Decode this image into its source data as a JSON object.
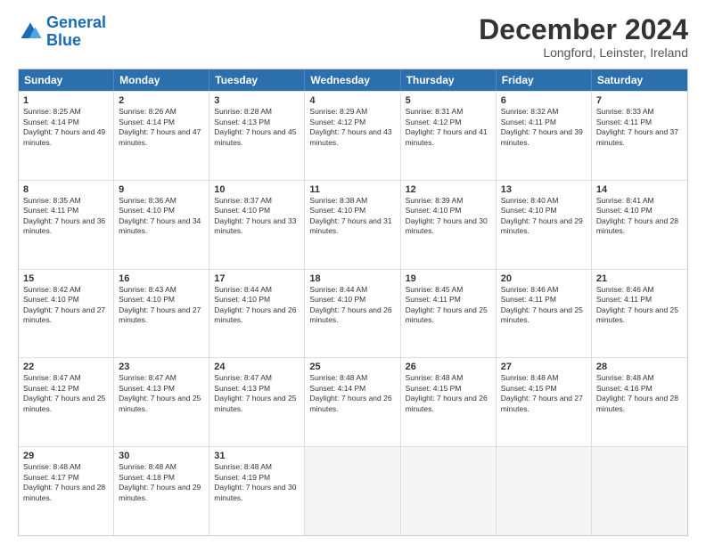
{
  "header": {
    "logo_line1": "General",
    "logo_line2": "Blue",
    "month": "December 2024",
    "location": "Longford, Leinster, Ireland"
  },
  "weekdays": [
    "Sunday",
    "Monday",
    "Tuesday",
    "Wednesday",
    "Thursday",
    "Friday",
    "Saturday"
  ],
  "weeks": [
    [
      {
        "day": "1",
        "rise": "Sunrise: 8:25 AM",
        "set": "Sunset: 4:14 PM",
        "daylight": "Daylight: 7 hours and 49 minutes."
      },
      {
        "day": "2",
        "rise": "Sunrise: 8:26 AM",
        "set": "Sunset: 4:14 PM",
        "daylight": "Daylight: 7 hours and 47 minutes."
      },
      {
        "day": "3",
        "rise": "Sunrise: 8:28 AM",
        "set": "Sunset: 4:13 PM",
        "daylight": "Daylight: 7 hours and 45 minutes."
      },
      {
        "day": "4",
        "rise": "Sunrise: 8:29 AM",
        "set": "Sunset: 4:12 PM",
        "daylight": "Daylight: 7 hours and 43 minutes."
      },
      {
        "day": "5",
        "rise": "Sunrise: 8:31 AM",
        "set": "Sunset: 4:12 PM",
        "daylight": "Daylight: 7 hours and 41 minutes."
      },
      {
        "day": "6",
        "rise": "Sunrise: 8:32 AM",
        "set": "Sunset: 4:11 PM",
        "daylight": "Daylight: 7 hours and 39 minutes."
      },
      {
        "day": "7",
        "rise": "Sunrise: 8:33 AM",
        "set": "Sunset: 4:11 PM",
        "daylight": "Daylight: 7 hours and 37 minutes."
      }
    ],
    [
      {
        "day": "8",
        "rise": "Sunrise: 8:35 AM",
        "set": "Sunset: 4:11 PM",
        "daylight": "Daylight: 7 hours and 36 minutes."
      },
      {
        "day": "9",
        "rise": "Sunrise: 8:36 AM",
        "set": "Sunset: 4:10 PM",
        "daylight": "Daylight: 7 hours and 34 minutes."
      },
      {
        "day": "10",
        "rise": "Sunrise: 8:37 AM",
        "set": "Sunset: 4:10 PM",
        "daylight": "Daylight: 7 hours and 33 minutes."
      },
      {
        "day": "11",
        "rise": "Sunrise: 8:38 AM",
        "set": "Sunset: 4:10 PM",
        "daylight": "Daylight: 7 hours and 31 minutes."
      },
      {
        "day": "12",
        "rise": "Sunrise: 8:39 AM",
        "set": "Sunset: 4:10 PM",
        "daylight": "Daylight: 7 hours and 30 minutes."
      },
      {
        "day": "13",
        "rise": "Sunrise: 8:40 AM",
        "set": "Sunset: 4:10 PM",
        "daylight": "Daylight: 7 hours and 29 minutes."
      },
      {
        "day": "14",
        "rise": "Sunrise: 8:41 AM",
        "set": "Sunset: 4:10 PM",
        "daylight": "Daylight: 7 hours and 28 minutes."
      }
    ],
    [
      {
        "day": "15",
        "rise": "Sunrise: 8:42 AM",
        "set": "Sunset: 4:10 PM",
        "daylight": "Daylight: 7 hours and 27 minutes."
      },
      {
        "day": "16",
        "rise": "Sunrise: 8:43 AM",
        "set": "Sunset: 4:10 PM",
        "daylight": "Daylight: 7 hours and 27 minutes."
      },
      {
        "day": "17",
        "rise": "Sunrise: 8:44 AM",
        "set": "Sunset: 4:10 PM",
        "daylight": "Daylight: 7 hours and 26 minutes."
      },
      {
        "day": "18",
        "rise": "Sunrise: 8:44 AM",
        "set": "Sunset: 4:10 PM",
        "daylight": "Daylight: 7 hours and 26 minutes."
      },
      {
        "day": "19",
        "rise": "Sunrise: 8:45 AM",
        "set": "Sunset: 4:11 PM",
        "daylight": "Daylight: 7 hours and 25 minutes."
      },
      {
        "day": "20",
        "rise": "Sunrise: 8:46 AM",
        "set": "Sunset: 4:11 PM",
        "daylight": "Daylight: 7 hours and 25 minutes."
      },
      {
        "day": "21",
        "rise": "Sunrise: 8:46 AM",
        "set": "Sunset: 4:11 PM",
        "daylight": "Daylight: 7 hours and 25 minutes."
      }
    ],
    [
      {
        "day": "22",
        "rise": "Sunrise: 8:47 AM",
        "set": "Sunset: 4:12 PM",
        "daylight": "Daylight: 7 hours and 25 minutes."
      },
      {
        "day": "23",
        "rise": "Sunrise: 8:47 AM",
        "set": "Sunset: 4:13 PM",
        "daylight": "Daylight: 7 hours and 25 minutes."
      },
      {
        "day": "24",
        "rise": "Sunrise: 8:47 AM",
        "set": "Sunset: 4:13 PM",
        "daylight": "Daylight: 7 hours and 25 minutes."
      },
      {
        "day": "25",
        "rise": "Sunrise: 8:48 AM",
        "set": "Sunset: 4:14 PM",
        "daylight": "Daylight: 7 hours and 26 minutes."
      },
      {
        "day": "26",
        "rise": "Sunrise: 8:48 AM",
        "set": "Sunset: 4:15 PM",
        "daylight": "Daylight: 7 hours and 26 minutes."
      },
      {
        "day": "27",
        "rise": "Sunrise: 8:48 AM",
        "set": "Sunset: 4:15 PM",
        "daylight": "Daylight: 7 hours and 27 minutes."
      },
      {
        "day": "28",
        "rise": "Sunrise: 8:48 AM",
        "set": "Sunset: 4:16 PM",
        "daylight": "Daylight: 7 hours and 28 minutes."
      }
    ],
    [
      {
        "day": "29",
        "rise": "Sunrise: 8:48 AM",
        "set": "Sunset: 4:17 PM",
        "daylight": "Daylight: 7 hours and 28 minutes."
      },
      {
        "day": "30",
        "rise": "Sunrise: 8:48 AM",
        "set": "Sunset: 4:18 PM",
        "daylight": "Daylight: 7 hours and 29 minutes."
      },
      {
        "day": "31",
        "rise": "Sunrise: 8:48 AM",
        "set": "Sunset: 4:19 PM",
        "daylight": "Daylight: 7 hours and 30 minutes."
      },
      {
        "day": "",
        "rise": "",
        "set": "",
        "daylight": ""
      },
      {
        "day": "",
        "rise": "",
        "set": "",
        "daylight": ""
      },
      {
        "day": "",
        "rise": "",
        "set": "",
        "daylight": ""
      },
      {
        "day": "",
        "rise": "",
        "set": "",
        "daylight": ""
      }
    ]
  ]
}
